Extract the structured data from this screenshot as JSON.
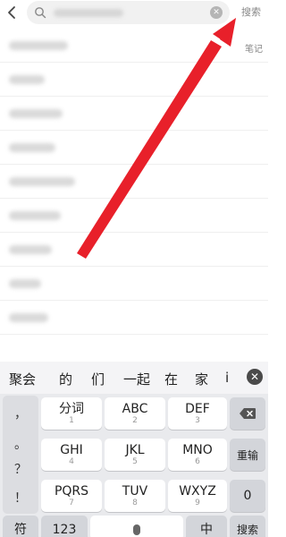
{
  "header": {
    "back_icon": "chevron-left-icon",
    "search_placeholder": "",
    "clear_icon": "clear-icon",
    "search_button": "搜索"
  },
  "list": {
    "note_label": "笔记",
    "rows": 9
  },
  "keyboard": {
    "candidates": [
      "聚会",
      "的",
      "们",
      "一起",
      "在",
      "家",
      "i"
    ],
    "symbols": [
      "，",
      "。",
      "？",
      "！"
    ],
    "keys": [
      {
        "main": "分词",
        "sub": "1"
      },
      {
        "main": "ABC",
        "sub": "2"
      },
      {
        "main": "DEF",
        "sub": "3"
      },
      {
        "main": "GHI",
        "sub": "4"
      },
      {
        "main": "JKL",
        "sub": "5"
      },
      {
        "main": "MNO",
        "sub": "6"
      },
      {
        "main": "PQRS",
        "sub": "7"
      },
      {
        "main": "TUV",
        "sub": "8"
      },
      {
        "main": "WXYZ",
        "sub": "9"
      }
    ],
    "backspace_icon": "backspace-icon",
    "reenter_label": "重输",
    "zero_label": "0",
    "bottom": {
      "symbol_label": "符",
      "num_label": "123",
      "lang_label": "中",
      "search_label": "搜索"
    }
  },
  "colors": {
    "arrow": "#e8202a"
  }
}
